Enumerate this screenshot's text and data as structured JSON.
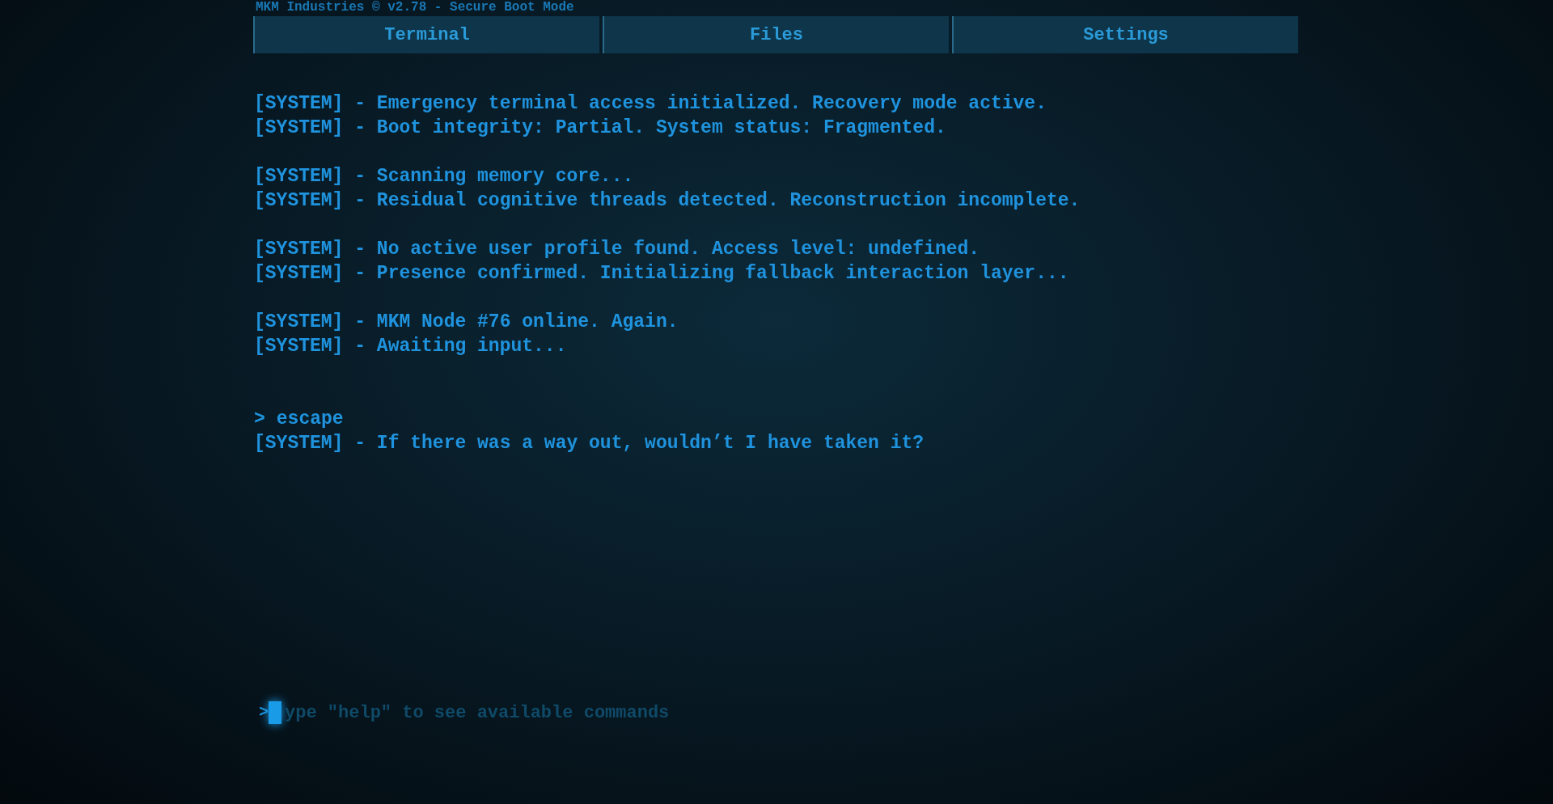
{
  "header": {
    "title": "MKM Industries © v2.78 - Secure Boot Mode"
  },
  "tabs": [
    {
      "label": "Terminal",
      "selected": false
    },
    {
      "label": "Files",
      "selected": false
    },
    {
      "label": "Settings",
      "selected": false
    }
  ],
  "log": [
    [
      {
        "kind": "system",
        "text": "[SYSTEM] - Emergency terminal access initialized. Recovery mode active."
      },
      {
        "kind": "system",
        "text": "[SYSTEM] - Boot integrity: Partial. System status: Fragmented."
      }
    ],
    [
      {
        "kind": "system",
        "text": "[SYSTEM] - Scanning memory core..."
      },
      {
        "kind": "system",
        "text": "[SYSTEM] - Residual cognitive threads detected. Reconstruction incomplete."
      }
    ],
    [
      {
        "kind": "system",
        "text": "[SYSTEM] - No active user profile found. Access level: undefined."
      },
      {
        "kind": "system",
        "text": "[SYSTEM] - Presence confirmed. Initializing fallback interaction layer..."
      }
    ],
    [
      {
        "kind": "system",
        "text": "[SYSTEM] - MKM Node #76 online. Again."
      },
      {
        "kind": "system",
        "text": "[SYSTEM] - Awaiting input..."
      }
    ],
    [
      {
        "kind": "command",
        "prompt": ">",
        "text": "escape"
      },
      {
        "kind": "system",
        "text": "[SYSTEM] - If there was a way out, wouldn’t I have taken it?"
      }
    ]
  ],
  "input": {
    "prompt": ">",
    "placeholder": "ype \"help\" to see available commands"
  }
}
